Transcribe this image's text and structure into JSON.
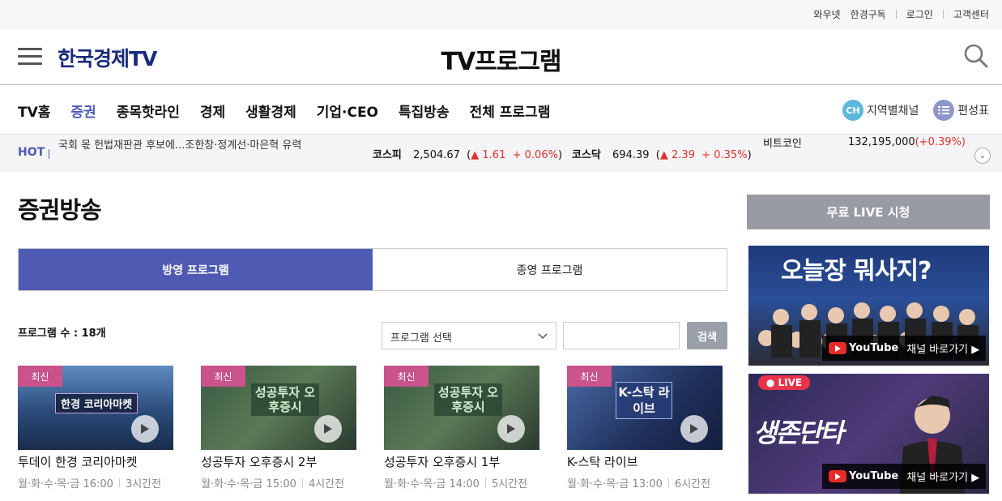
{
  "util": {
    "links": [
      "와우넷",
      "한경구독",
      "로그인",
      "고객센터"
    ]
  },
  "header": {
    "logo": "한국경제TV",
    "title": "TV프로그램"
  },
  "nav": {
    "items": [
      "TV홈",
      "증권",
      "종목핫라인",
      "경제",
      "생활경제",
      "기업·CEO",
      "특집방송",
      "전체 프로그램"
    ],
    "active": "증권",
    "regional_badge": "CH",
    "regional_label": "지역별채널",
    "schedule_label": "편성표"
  },
  "ticker": {
    "hot_label": "HOT",
    "headline": "국회 몫 헌법재판관 후보에...조한창·정계선·마은혁 유력",
    "kospi": {
      "name": "코스피",
      "value": "2,504.67",
      "change": "1.61",
      "rate": "+ 0.06%"
    },
    "kosdaq": {
      "name": "코스닥",
      "value": "694.39",
      "change": "2.39",
      "rate": "+ 0.35%"
    },
    "coin": {
      "name": "비트코인",
      "value": "132,195,000",
      "rate": "(+0.39%)"
    }
  },
  "main": {
    "section_title": "증권방송",
    "tabs": [
      "방영 프로그램",
      "종영 프로그램"
    ],
    "active_tab": "방영 프로그램",
    "count_label": "프로그램 수 : 18개",
    "select_placeholder": "프로그램 선택",
    "search_button": "검색",
    "cards": [
      {
        "badge": "최신",
        "thumb_text": "한경 코리아마켓",
        "title": "투데이 한경 코리아마켓",
        "schedule": "월·화·수·목·금 16:00",
        "ago": "3시간전",
        "bg": "#2a4a7a"
      },
      {
        "badge": "최신",
        "thumb_text": "성공투자 오후증시",
        "title": "성공투자 오후증시 2부",
        "schedule": "월·화·수·목·금 15:00",
        "ago": "4시간전",
        "bg": "#2e4a3a"
      },
      {
        "badge": "최신",
        "thumb_text": "성공투자 오후증시",
        "title": "성공투자 오후증시 1부",
        "schedule": "월·화·수·목·금 14:00",
        "ago": "5시간전",
        "bg": "#2e4a3a"
      },
      {
        "badge": "최신",
        "thumb_text": "K-스탁 라이브",
        "title": "K-스탁 라이브",
        "schedule": "월·화·수·목·금 13:00",
        "ago": "6시간전",
        "bg": "#1e2f5a"
      }
    ]
  },
  "side": {
    "head": "무료 LIVE 시청",
    "banner1_title": "오늘장 뭐사지?",
    "banner2_title": "생존단타",
    "live_label": "● LIVE",
    "yt_label": "YouTube",
    "yt_cta": "채널 바로가기 ▶"
  }
}
